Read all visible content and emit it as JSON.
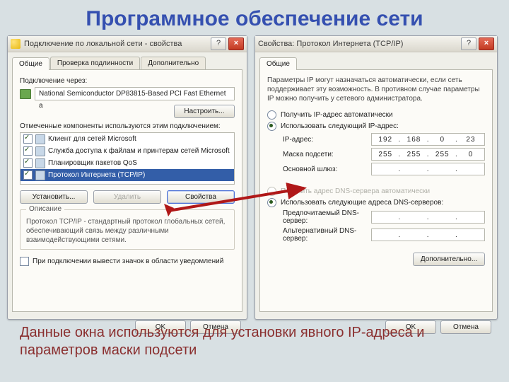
{
  "slide": {
    "title": "Программное обеспечение сети",
    "caption": "Данные окна используются для установки явного IP-адреса и параметров маски подсети"
  },
  "left": {
    "title": "Подключение по локальной сети - свойства",
    "tabs": [
      "Общие",
      "Проверка подлинности",
      "Дополнительно"
    ],
    "connect_via_label": "Подключение через:",
    "adapter": "National Semiconductor DP83815-Based PCI Fast Ethernet a",
    "configure_btn": "Настроить...",
    "components_label": "Отмеченные компоненты используются этим подключением:",
    "components": [
      "Клиент для сетей Microsoft",
      "Служба доступа к файлам и принтерам сетей Microsoft",
      "Планировщик пакетов QoS",
      "Протокол Интернета (TCP/IP)"
    ],
    "install_btn": "Установить...",
    "remove_btn": "Удалить",
    "props_btn": "Свойства",
    "desc_title": "Описание",
    "desc_text": "Протокол TCP/IP - стандартный протокол глобальных сетей, обеспечивающий связь между различными взаимодействующими сетями.",
    "tray_label": "При подключении вывести значок в области уведомлений",
    "ok": "OK",
    "cancel": "Отмена"
  },
  "right": {
    "title": "Свойства: Протокол Интернета (TCP/IP)",
    "tab": "Общие",
    "info": "Параметры IP могут назначаться автоматически, если сеть поддерживает эту возможность. В противном случае параметры IP можно получить у сетевого администратора.",
    "radio_auto_ip": "Получить IP-адрес автоматически",
    "radio_static_ip": "Использовать следующий IP-адрес:",
    "ip_label": "IP-адрес:",
    "ip": [
      "192",
      "168",
      "0",
      "23"
    ],
    "mask_label": "Маска подсети:",
    "mask": [
      "255",
      "255",
      "255",
      "0"
    ],
    "gw_label": "Основной шлюз:",
    "radio_auto_dns": "Получить адрес DNS-сервера автоматически",
    "radio_static_dns": "Использовать следующие адреса DNS-серверов:",
    "dns1_label": "Предпочитаемый DNS-сервер:",
    "dns2_label": "Альтернативный DNS-сервер:",
    "advanced_btn": "Дополнительно...",
    "ok": "OK",
    "cancel": "Отмена"
  }
}
